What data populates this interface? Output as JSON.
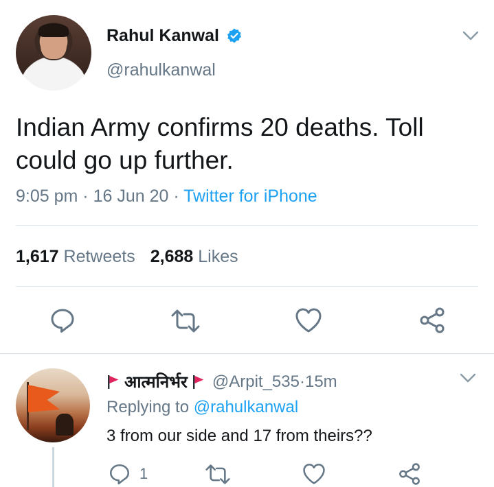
{
  "tweet": {
    "author_name": "Rahul Kanwal",
    "handle": "@rahulkanwal",
    "text": "Indian Army confirms 20 deaths. Toll could go up further.",
    "time": "9:05 pm",
    "date": "16 Jun 20",
    "source": "Twitter for iPhone",
    "separator": " · ",
    "retweets_count": "1,617",
    "retweets_label": "Retweets",
    "likes_count": "2,688",
    "likes_label": "Likes",
    "verified": true
  },
  "reply": {
    "author_name": "आत्मनिर्भर",
    "handle": "@Arpit_535",
    "separator": " · ",
    "time": "15m",
    "replying_to_label": "Replying to",
    "replying_to_handle": "@rahulkanwal",
    "text": "3 from our side and 17 from theirs??",
    "reply_count": "1"
  },
  "icons": {
    "verified": "verified-badge-icon",
    "more": "chevron-down-icon",
    "reply": "reply-icon",
    "retweet": "retweet-icon",
    "like": "heart-icon",
    "share": "share-icon",
    "flag": "red-flag-icon"
  },
  "colors": {
    "link": "#1da1f2",
    "text": "#14171a",
    "secondary": "#657786",
    "divider": "#e1e8ed",
    "flag": "#e0245e"
  }
}
